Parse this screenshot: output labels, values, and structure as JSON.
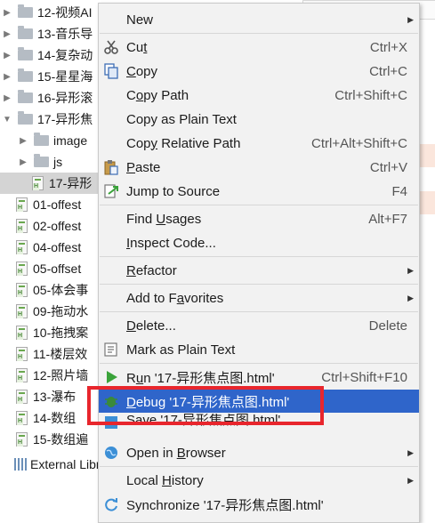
{
  "tree": {
    "rows": [
      {
        "label": "12-视频AI",
        "type": "folder",
        "arrow": "▶"
      },
      {
        "label": "13-音乐导",
        "type": "folder",
        "arrow": "▶"
      },
      {
        "label": "14-复杂动",
        "type": "folder",
        "arrow": "▶"
      },
      {
        "label": "15-星星海",
        "type": "folder",
        "arrow": "▶"
      },
      {
        "label": "16-异形滚",
        "type": "folder",
        "arrow": "▶"
      },
      {
        "label": "17-异形焦",
        "type": "folder",
        "arrow": "▼"
      },
      {
        "label": "image",
        "type": "folder",
        "arrow": "▶"
      },
      {
        "label": "js",
        "type": "folder",
        "arrow": "▶"
      },
      {
        "label": "17-异形",
        "type": "file",
        "arrow": ""
      },
      {
        "label": "01-offest",
        "type": "file",
        "arrow": ""
      },
      {
        "label": "02-offest",
        "type": "file",
        "arrow": ""
      },
      {
        "label": "04-offest",
        "type": "file",
        "arrow": ""
      },
      {
        "label": "05-offset",
        "type": "file",
        "arrow": ""
      },
      {
        "label": "05-体会事",
        "type": "file",
        "arrow": ""
      },
      {
        "label": "09-拖动水",
        "type": "file",
        "arrow": ""
      },
      {
        "label": "10-拖拽案",
        "type": "file",
        "arrow": ""
      },
      {
        "label": "11-楼层效",
        "type": "file",
        "arrow": ""
      },
      {
        "label": "12-照片墙",
        "type": "file",
        "arrow": ""
      },
      {
        "label": "13-瀑布",
        "type": "file",
        "arrow": ""
      },
      {
        "label": "14-数组",
        "type": "file",
        "arrow": ""
      },
      {
        "label": "15-数组遍",
        "type": "file",
        "arrow": ""
      },
      {
        "label": "External Libra",
        "type": "lib",
        "arrow": ""
      }
    ]
  },
  "menu": {
    "new": {
      "label": "New"
    },
    "cut": {
      "pre": "Cu",
      "u": "t",
      "post": "",
      "shortcut": "Ctrl+X"
    },
    "copy": {
      "pre": "",
      "u": "C",
      "post": "opy",
      "shortcut": "Ctrl+C"
    },
    "copy_path": {
      "pre": "C",
      "u": "o",
      "post": "py Path",
      "shortcut": "Ctrl+Shift+C"
    },
    "copy_plain": {
      "label": "Copy as Plain Text"
    },
    "copy_relative": {
      "pre": "Cop",
      "u": "y",
      "post": " Relative Path",
      "shortcut": "Ctrl+Alt+Shift+C"
    },
    "paste": {
      "pre": "",
      "u": "P",
      "post": "aste",
      "shortcut": "Ctrl+V"
    },
    "jump": {
      "label": "Jump to Source",
      "shortcut": "F4"
    },
    "find_usages": {
      "pre": "Find ",
      "u": "U",
      "post": "sages",
      "shortcut": "Alt+F7"
    },
    "inspect": {
      "pre": "",
      "u": "I",
      "post": "nspect Code...",
      "shortcut": ""
    },
    "refactor": {
      "pre": "",
      "u": "R",
      "post": "efactor"
    },
    "favorites": {
      "pre": "Add to F",
      "u": "a",
      "post": "vorites"
    },
    "delete": {
      "pre": "",
      "u": "D",
      "post": "elete...",
      "shortcut": "Delete"
    },
    "mark_plain": {
      "label": "Mark as Plain Text"
    },
    "run": {
      "pre": "R",
      "u": "u",
      "post": "n '17-异形焦点图.html'",
      "shortcut": "Ctrl+Shift+F10"
    },
    "debug": {
      "pre": "",
      "u": "D",
      "post": "ebug '17-异形焦点图.html'"
    },
    "save": {
      "label": "Save '17-异形焦点图.html'"
    },
    "browser": {
      "pre": "Open in ",
      "u": "B",
      "post": "rowser"
    },
    "local_history": {
      "pre": "Local ",
      "u": "H",
      "post": "istory"
    },
    "synchronize": {
      "label": "Synchronize '17-异形焦点图.html'"
    }
  },
  "colors": {
    "highlight": "#2f65ca",
    "annotation": "#e8262d",
    "run": "#3aa33a",
    "debug": "#3a8a3a",
    "browser": "#3c8fd6"
  },
  "icons": [
    "cut-icon",
    "copy-icon",
    "paste-icon",
    "jump-to-source-icon",
    "delete-icon",
    "mark-plain-text-icon",
    "run-icon",
    "debug-icon",
    "save-icon",
    "browser-icon",
    "synchronize-icon"
  ]
}
